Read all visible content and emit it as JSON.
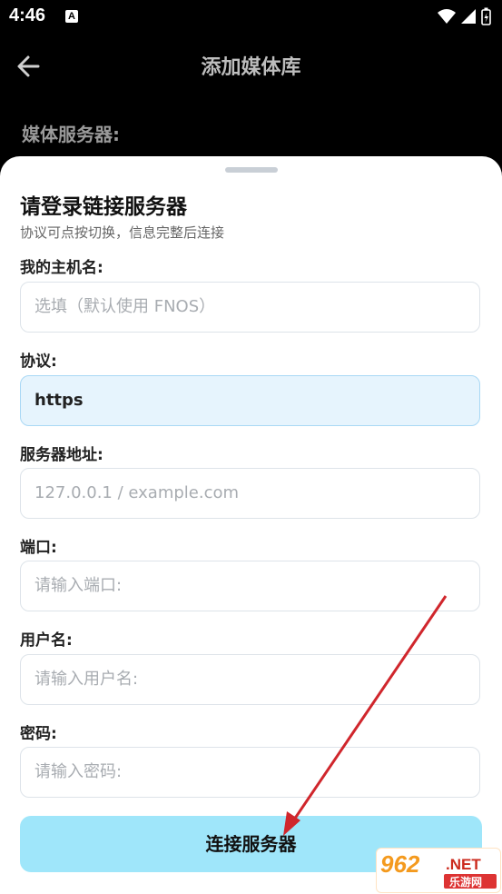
{
  "status_bar": {
    "time": "4:46",
    "notification_badge": "A"
  },
  "app_bar": {
    "title": "添加媒体库",
    "back_icon": "arrow-left-icon"
  },
  "background_label": "媒体服务器:",
  "sheet": {
    "title": "请登录链接服务器",
    "subtitle": "协议可点按切换，信息完整后连接",
    "fields": {
      "hostname": {
        "label": "我的主机名:",
        "placeholder": "选填（默认使用 FNOS）",
        "value": ""
      },
      "protocol": {
        "label": "协议:",
        "value": "https"
      },
      "server_address": {
        "label": "服务器地址:",
        "placeholder": "127.0.0.1 / example.com",
        "value": ""
      },
      "port": {
        "label": "端口:",
        "placeholder": "请输入端口:",
        "value": ""
      },
      "username": {
        "label": "用户名:",
        "placeholder": "请输入用户名:",
        "value": ""
      },
      "password": {
        "label": "密码:",
        "placeholder": "请输入密码:",
        "value": ""
      }
    },
    "connect_label": "连接服务器"
  },
  "watermark": {
    "number": "962",
    "domain": ".NET",
    "cn_text": "乐游网"
  },
  "colors": {
    "accent_button": "#9fe6fa",
    "active_field_bg": "#e6f4fd",
    "annotation_arrow": "#d0262c"
  }
}
